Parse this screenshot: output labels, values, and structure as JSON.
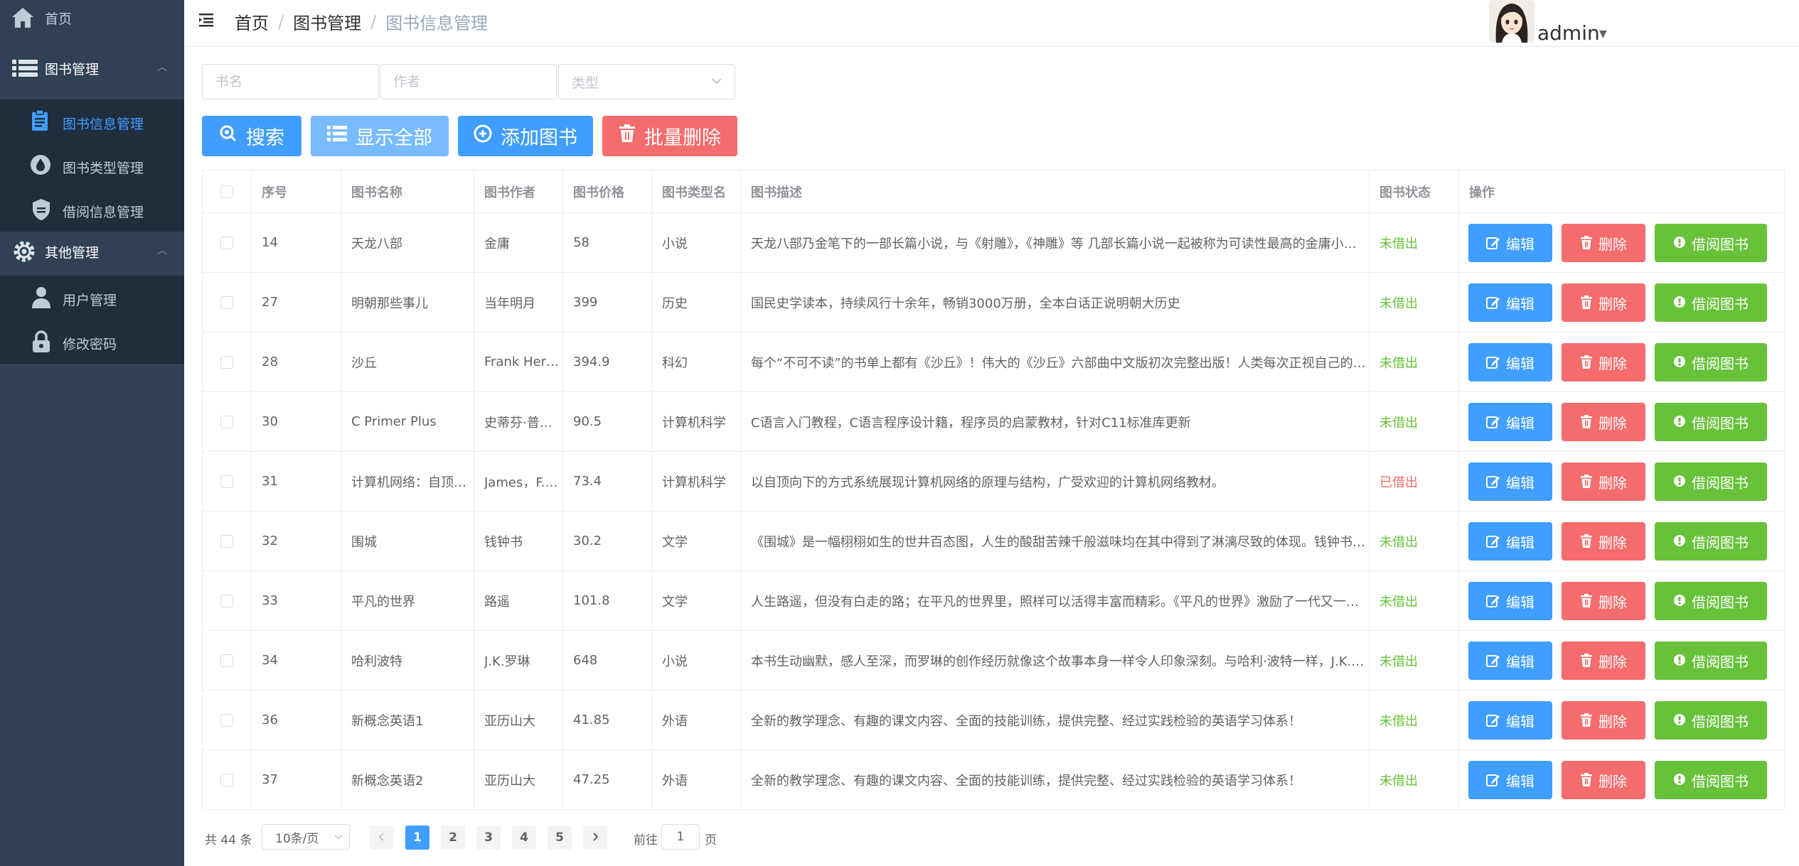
{
  "sidebar": {
    "home": "首页",
    "book_management": "图书管理",
    "book_info": "图书信息管理",
    "book_type": "图书类型管理",
    "borrow_info": "借阅信息管理",
    "other_management": "其他管理",
    "user_management": "用户管理",
    "change_password": "修改密码"
  },
  "header": {
    "breadcrumb": [
      "首页",
      "图书管理",
      "图书信息管理"
    ],
    "separator": "/",
    "username": "admin"
  },
  "search": {
    "book_name_placeholder": "书名",
    "author_placeholder": "作者",
    "type_placeholder": "类型"
  },
  "toolbar": {
    "search": "搜索",
    "show_all": "显示全部",
    "add_book": "添加图书",
    "batch_delete": "批量删除"
  },
  "colors": {
    "primary": "#409eff",
    "primary_light": "#79bbff",
    "danger": "#f56c6c",
    "success": "#67c23a",
    "sidebar_bg": "#304156",
    "sidebar_sub_bg": "#1f2d3d"
  },
  "table": {
    "columns": [
      "序号",
      "图书名称",
      "图书作者",
      "图书价格",
      "图书类型名",
      "图书描述",
      "图书状态",
      "操作"
    ],
    "action_labels": {
      "edit": "编辑",
      "delete": "删除",
      "borrow": "借阅图书"
    },
    "rows": [
      {
        "id": "14",
        "name": "天龙八部",
        "author": "金庸",
        "price": "58",
        "type": "小说",
        "desc": "天龙八部乃金笔下的一部长篇小说，与《射雕》，《神雕》等 几部长篇小说一起被称为可读性最高的金庸小说。",
        "status": "未借出",
        "borrowed": false
      },
      {
        "id": "27",
        "name": "明朝那些事儿",
        "author": "当年明月",
        "price": "399",
        "type": "历史",
        "desc": "国民史学读本，持续风行十余年，畅销3000万册，全本白话正说明朝大历史",
        "status": "未借出",
        "borrowed": false
      },
      {
        "id": "28",
        "name": "沙丘",
        "author": "Frank Herbert",
        "price": "394.9",
        "type": "科幻",
        "desc": "每个“不可不读”的书单上都有《沙丘》！伟大的《沙丘》六部曲中文版初次完整出版！人类每次正视自己的渺小，都是自身的一次巨大进步。",
        "status": "未借出",
        "borrowed": false
      },
      {
        "id": "30",
        "name": "C Primer Plus",
        "author": "史蒂芬·普拉达",
        "price": "90.5",
        "type": "计算机科学",
        "desc": "C语言入门教程，C语言程序设计籍，程序员的启蒙教材，针对C11标准库更新",
        "status": "未借出",
        "borrowed": false
      },
      {
        "id": "31",
        "name": "计算机网络：自顶向下方法",
        "author": "James，F.Kurose",
        "price": "73.4",
        "type": "计算机科学",
        "desc": "以自顶向下的方式系统展现计算机网络的原理与结构，广受欢迎的计算机网络教材。",
        "status": "已借出",
        "borrowed": true
      },
      {
        "id": "32",
        "name": "围城",
        "author": "钱钟书",
        "price": "30.2",
        "type": "文学",
        "desc": "《围城》是一幅栩栩如生的世井百态图，人生的酸甜苦辣千般滋味均在其中得到了淋漓尽致的体现。钱钟书先生将自己的语言天才并入到创作中。",
        "status": "未借出",
        "borrowed": false
      },
      {
        "id": "33",
        "name": "平凡的世界",
        "author": "路遥",
        "price": "101.8",
        "type": "文学",
        "desc": "人生路遥，但没有白走的路；在平凡的世界里，照样可以活得丰富而精彩。《平凡的世界》激励了一代又一代的年轻人。",
        "status": "未借出",
        "borrowed": false
      },
      {
        "id": "34",
        "name": "哈利波特",
        "author": "J.K.罗琳",
        "price": "648",
        "type": "小说",
        "desc": "本书生动幽默，感人至深，而罗琳的创作经历就像这个故事本身一样令人印象深刻。与哈利·波特一样，J.K.罗琳的生活也充满了传奇色彩。",
        "status": "未借出",
        "borrowed": false
      },
      {
        "id": "36",
        "name": "新概念英语1",
        "author": "亚历山大",
        "price": "41.85",
        "type": "外语",
        "desc": "全新的教学理念、有趣的课文内容、全面的技能训练，提供完整、经过实践检验的英语学习体系！",
        "status": "未借出",
        "borrowed": false
      },
      {
        "id": "37",
        "name": "新概念英语2",
        "author": "亚历山大",
        "price": "47.25",
        "type": "外语",
        "desc": "全新的教学理念、有趣的课文内容、全面的技能训练，提供完整、经过实践检验的英语学习体系！",
        "status": "未借出",
        "borrowed": false
      }
    ]
  },
  "pagination": {
    "total": "共 44 条",
    "page_size": "10条/页",
    "pages": [
      "1",
      "2",
      "3",
      "4",
      "5"
    ],
    "current_page": "1",
    "goto_prefix": "前往",
    "goto_value": "1",
    "goto_suffix": "页"
  }
}
